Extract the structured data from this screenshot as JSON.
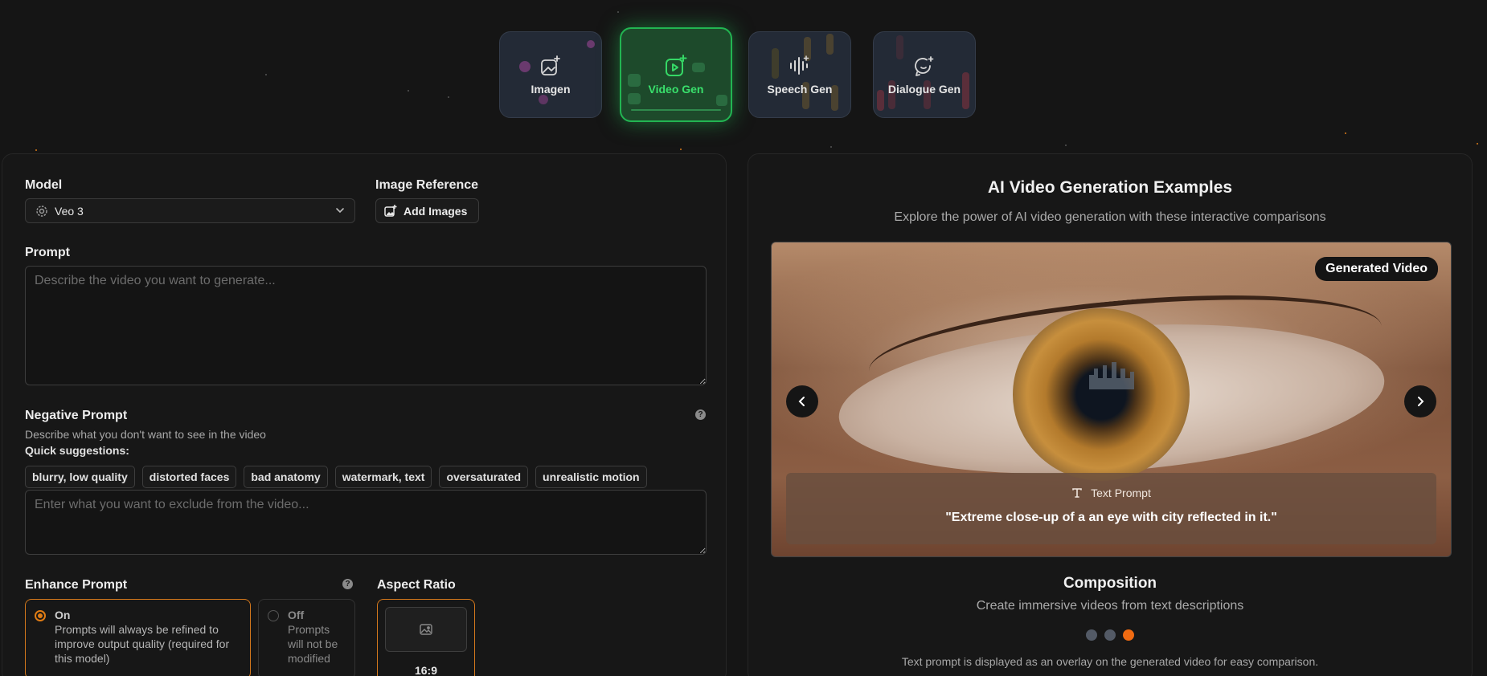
{
  "tabs": [
    {
      "label": "Imagen",
      "icon": "image-sparkle-icon",
      "active": false
    },
    {
      "label": "Video Gen",
      "icon": "video-sparkle-icon",
      "active": true
    },
    {
      "label": "Speech Gen",
      "icon": "audio-wave-sparkle-icon",
      "active": false
    },
    {
      "label": "Dialogue Gen",
      "icon": "chat-sparkle-icon",
      "active": false
    }
  ],
  "form": {
    "model_label": "Model",
    "model_value": "Veo 3",
    "image_ref_label": "Image Reference",
    "add_images_label": "Add Images",
    "prompt_label": "Prompt",
    "prompt_placeholder": "Describe the video you want to generate...",
    "negative_label": "Negative Prompt",
    "negative_description": "Describe what you don't want to see in the video",
    "quick_label": "Quick suggestions:",
    "suggestions": [
      "blurry, low quality",
      "distorted faces",
      "bad anatomy",
      "watermark, text",
      "oversaturated",
      "unrealistic motion"
    ],
    "negative_placeholder": "Enter what you want to exclude from the video...",
    "enhance_label": "Enhance Prompt",
    "enhance_on_title": "On",
    "enhance_on_desc": "Prompts will always be refined to improve output quality (required for this model)",
    "enhance_off_title": "Off",
    "enhance_off_desc": "Prompts will not be modified",
    "aspect_label": "Aspect Ratio",
    "aspect_value": "16:9",
    "help_glyph": "?"
  },
  "examples": {
    "title": "AI Video Generation Examples",
    "subtitle": "Explore the power of AI video generation with these interactive comparisons",
    "badge": "Generated Video",
    "prompt_type": "Text Prompt",
    "prompt_text": "\"Extreme close-up of a an eye with city reflected in it.\"",
    "caption_title": "Composition",
    "caption_subtitle": "Create immersive videos from text descriptions",
    "note": "Text prompt is displayed as an overlay on the generated video for easy comparison.",
    "slide_count": 3,
    "active_slide": 3
  },
  "colors": {
    "accent_green": "#22b552",
    "accent_orange": "#e07c14",
    "background": "#151515"
  }
}
